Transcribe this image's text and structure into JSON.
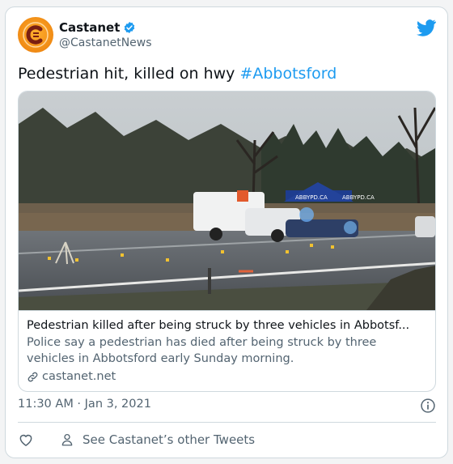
{
  "author": {
    "name": "Castanet",
    "handle": "@CastanetNews",
    "verified": true
  },
  "tweet": {
    "text_prefix": "Pedestrian hit, killed on hwy ",
    "hashtag": "#Abbotsford"
  },
  "link_card": {
    "title": "Pedestrian killed after being struck by three vehicles in Abbotsf...",
    "description": "Police say a pedestrian has died after being struck by three vehicles in Abbotsford early Sunday morning.",
    "domain": "castanet.net",
    "photo_labels": [
      "ABBYPD.CA",
      "ABBYPD.CA"
    ]
  },
  "meta": {
    "timestamp": "11:30 AM · Jan 3, 2021"
  },
  "actions": {
    "other_tweets_label": "See Castanet’s other Tweets"
  },
  "colors": {
    "accent": "#1d9bf0",
    "muted": "#536471",
    "border": "#cfd9de",
    "avatar": "#f08a14"
  },
  "icons": [
    "castanet-logo",
    "verified-badge-icon",
    "twitter-bird-icon",
    "link-icon",
    "info-icon",
    "heart-icon",
    "person-icon"
  ]
}
